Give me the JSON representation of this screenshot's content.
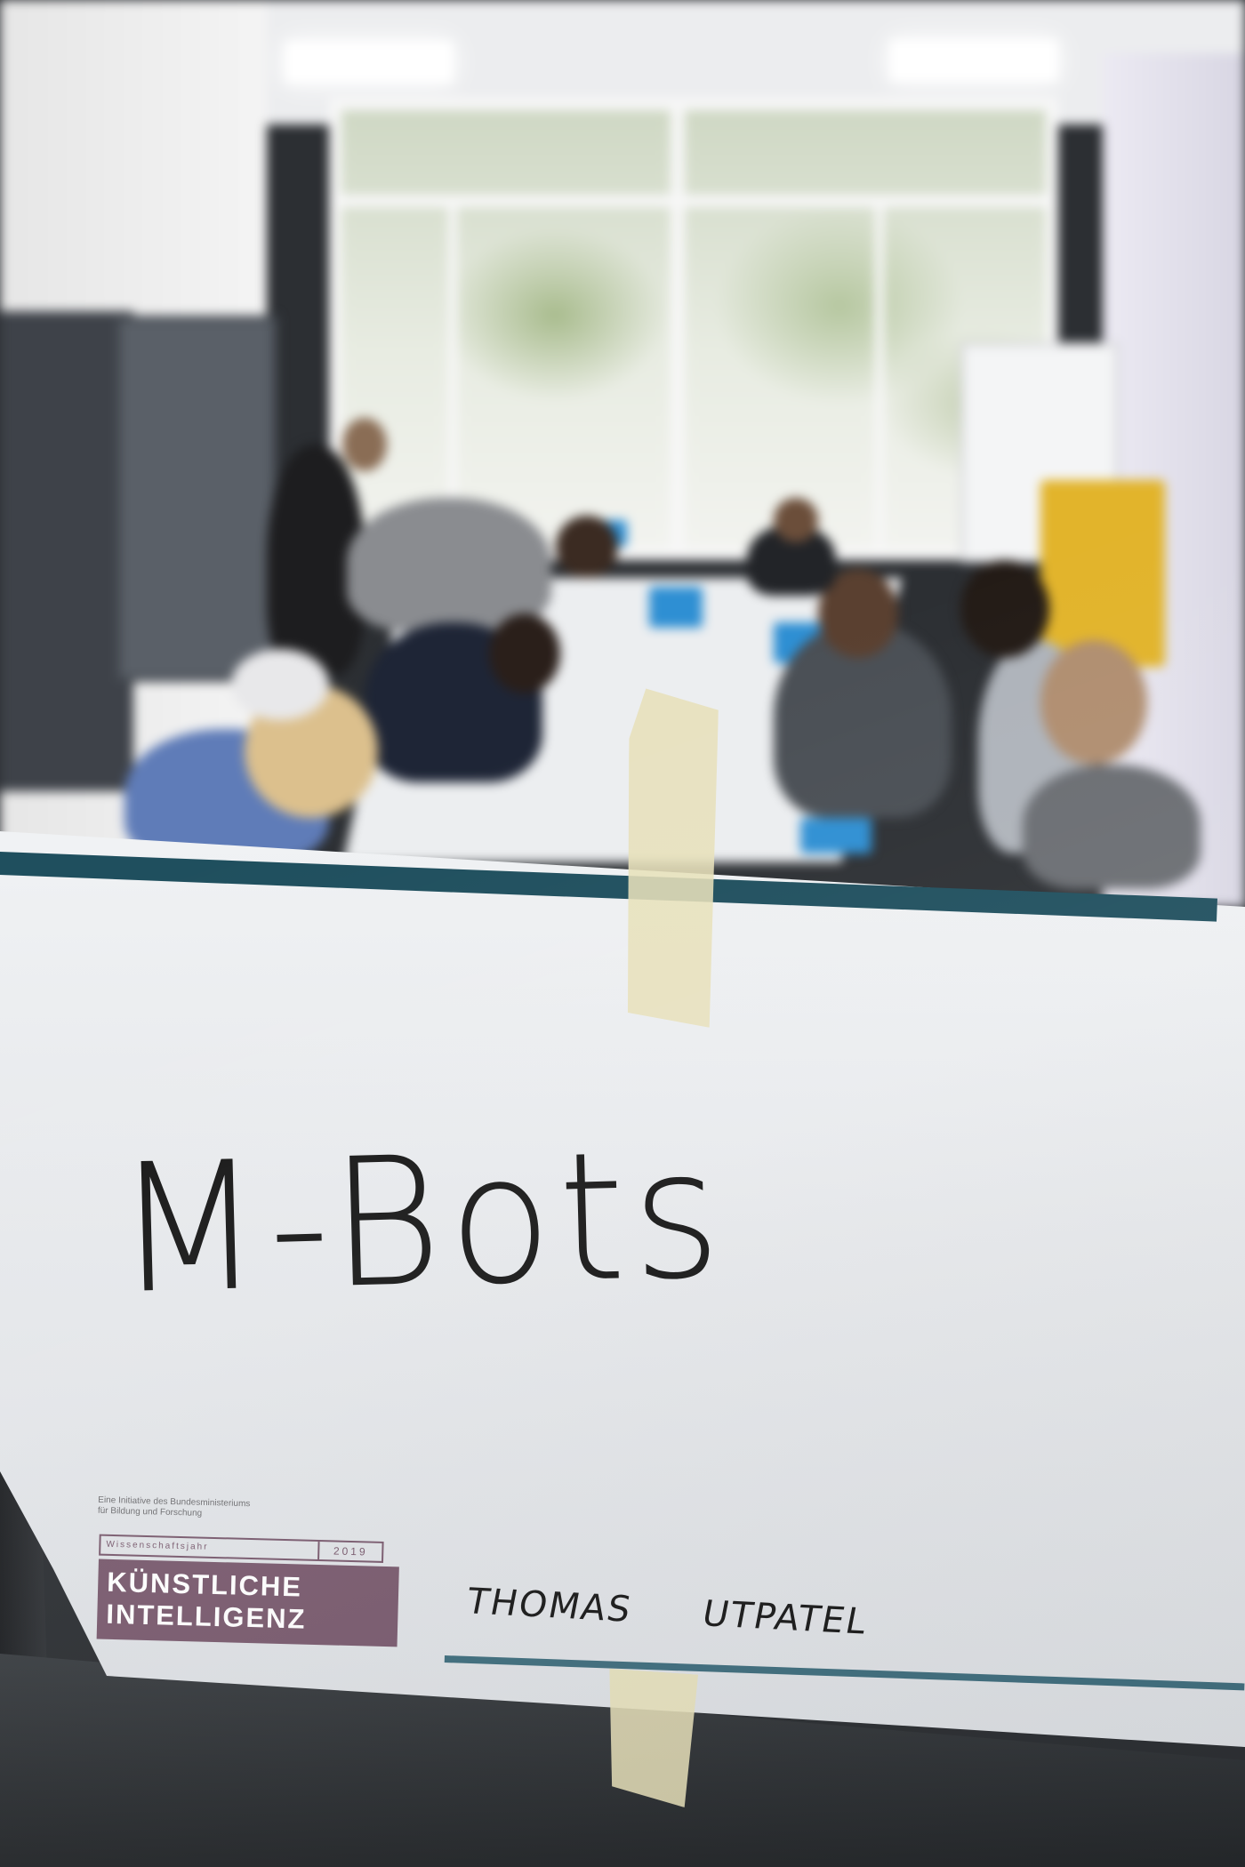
{
  "sign": {
    "title": "M-Bots",
    "author_first": "THOMAS",
    "author_last": "UTPATEL",
    "initiative_line1": "Eine Initiative des Bundesministeriums",
    "initiative_line2": "für Bildung und Forschung",
    "logo_label": "Wissenschaftsjahr",
    "logo_year": "2019",
    "logo_line1": "KÜNSTLICHE",
    "logo_line2": "INTELLIGENZ"
  },
  "colors": {
    "stripe": "#1f4f5e",
    "logo": "#7a5b6f",
    "cabinet": "#e2b42b"
  }
}
